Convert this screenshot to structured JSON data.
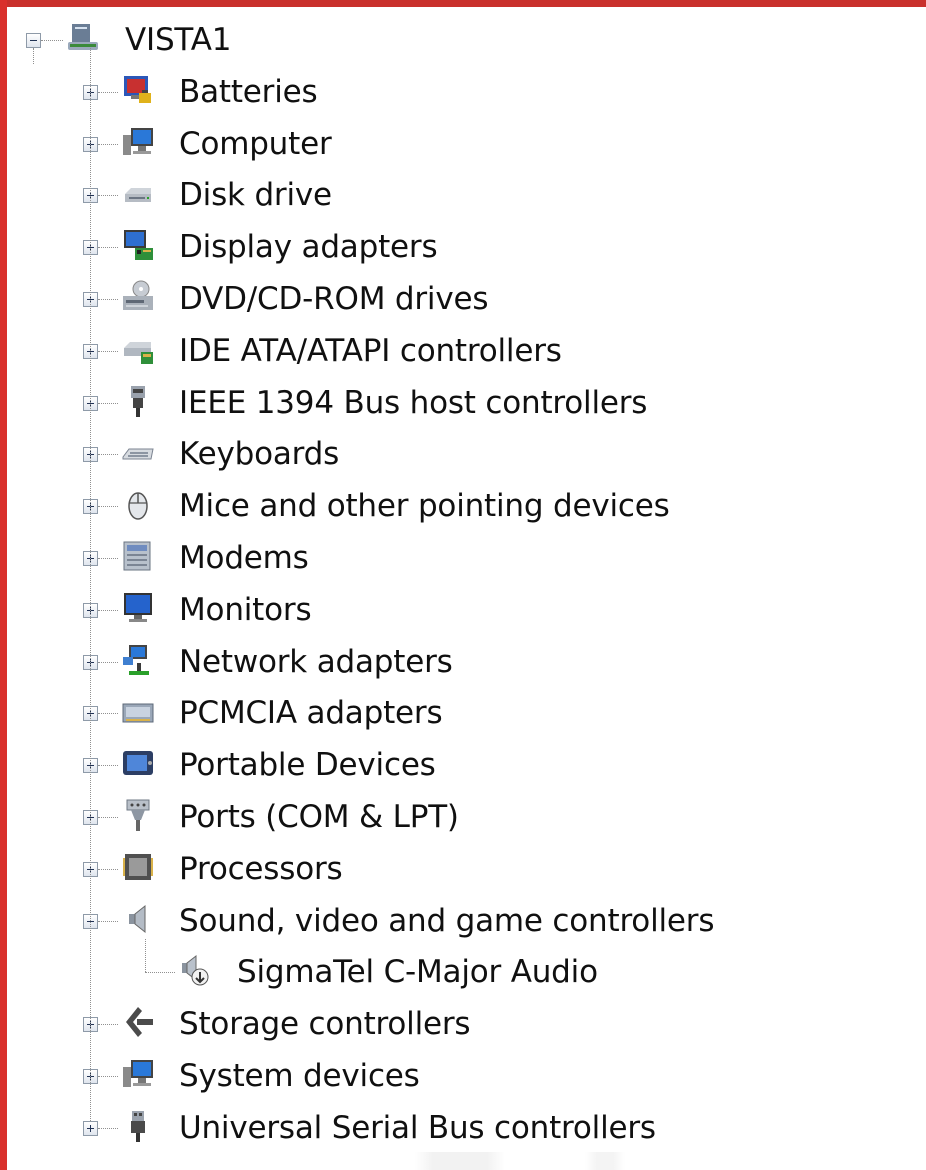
{
  "root": {
    "label": "VISTA1",
    "expanded": true,
    "icon": "computer-root-icon"
  },
  "categories": [
    {
      "label": "Batteries",
      "icon": "batteries-icon",
      "expanded": false
    },
    {
      "label": "Computer",
      "icon": "computer-icon",
      "expanded": false
    },
    {
      "label": "Disk drive",
      "icon": "disk-drive-icon",
      "expanded": false
    },
    {
      "label": "Display adapters",
      "icon": "display-adapter-icon",
      "expanded": false
    },
    {
      "label": "DVD/CD-ROM drives",
      "icon": "dvd-drive-icon",
      "expanded": false
    },
    {
      "label": "IDE ATA/ATAPI controllers",
      "icon": "ide-controller-icon",
      "expanded": false
    },
    {
      "label": "IEEE 1394 Bus host controllers",
      "icon": "ieee1394-icon",
      "expanded": false
    },
    {
      "label": "Keyboards",
      "icon": "keyboard-icon",
      "expanded": false
    },
    {
      "label": "Mice and other pointing devices",
      "icon": "mouse-icon",
      "expanded": false
    },
    {
      "label": "Modems",
      "icon": "modem-icon",
      "expanded": false
    },
    {
      "label": "Monitors",
      "icon": "monitor-icon",
      "expanded": false
    },
    {
      "label": "Network adapters",
      "icon": "network-adapter-icon",
      "expanded": false
    },
    {
      "label": "PCMCIA adapters",
      "icon": "pcmcia-icon",
      "expanded": false
    },
    {
      "label": "Portable Devices",
      "icon": "portable-device-icon",
      "expanded": false
    },
    {
      "label": "Ports (COM & LPT)",
      "icon": "ports-icon",
      "expanded": false
    },
    {
      "label": "Processors",
      "icon": "processor-icon",
      "expanded": false
    },
    {
      "label": "Sound, video and game controllers",
      "icon": "speaker-icon",
      "expanded": true,
      "children": [
        {
          "label": "SigmaTel C-Major Audio",
          "icon": "audio-device-icon"
        }
      ]
    },
    {
      "label": "Storage controllers",
      "icon": "storage-controller-icon",
      "expanded": false
    },
    {
      "label": "System devices",
      "icon": "system-device-icon",
      "expanded": false
    },
    {
      "label": "Universal Serial Bus controllers",
      "icon": "usb-icon",
      "expanded": false
    }
  ],
  "colors": {
    "frame": "#d9302c",
    "text": "#101010",
    "icon_blue": "#1f4fb0"
  }
}
